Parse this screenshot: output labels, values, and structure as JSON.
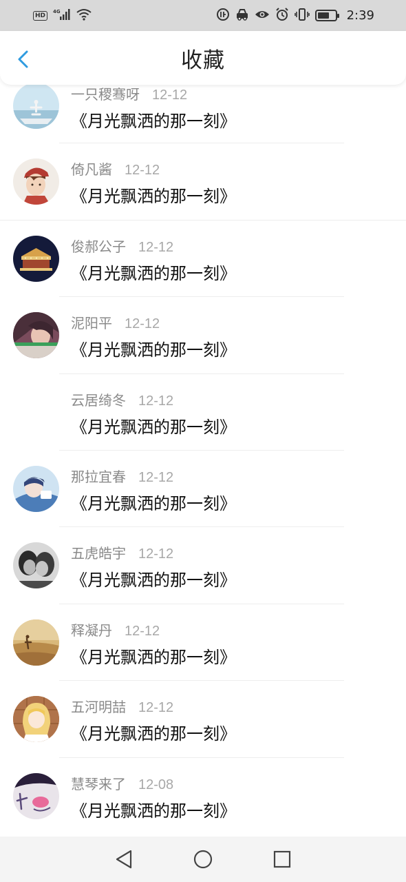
{
  "status_bar": {
    "left_icons": [
      "hd-icon",
      "signal-4g-icon",
      "wifi-icon"
    ],
    "hd_label": "HD",
    "network_label": "4G",
    "right_icons": [
      "data-saver-icon",
      "car-icon",
      "eye-icon",
      "alarm-icon",
      "vibrate-icon",
      "battery-icon"
    ],
    "battery_level": 0.7,
    "time": "2:39"
  },
  "header": {
    "title": "收藏",
    "back_icon": "chevron-left-icon",
    "accent_color": "#2f9be0"
  },
  "favorites": [
    {
      "user": "一只稷骞呀",
      "date": "12-12",
      "title": "《月光飘洒的那一刻》",
      "avatar": "yoga-figure-avatar"
    },
    {
      "user": "倚凡酱",
      "date": "12-12",
      "title": "《月光飘洒的那一刻》",
      "avatar": "anime-boy-red-cap-avatar"
    },
    {
      "user": "俊郝公子",
      "date": "12-12",
      "title": "《月光飘洒的那一刻》",
      "avatar": "carousel-night-avatar"
    },
    {
      "user": "泥阳平",
      "date": "12-12",
      "title": "《月光飘洒的那一刻》",
      "avatar": "girl-portrait-avatar"
    },
    {
      "user": "云居绮冬",
      "date": "12-12",
      "title": "《月光飘洒的那一刻》",
      "avatar": "blank-avatar"
    },
    {
      "user": "那拉宜春",
      "date": "12-12",
      "title": "《月光飘洒的那一刻》",
      "avatar": "blue-anime-avatar"
    },
    {
      "user": "五虎皓宇",
      "date": "12-12",
      "title": "《月光飘洒的那一刻》",
      "avatar": "couple-kiss-avatar"
    },
    {
      "user": "释凝丹",
      "date": "12-12",
      "title": "《月光飘洒的那一刻》",
      "avatar": "desert-figure-avatar"
    },
    {
      "user": "五河明喆",
      "date": "12-12",
      "title": "《月光飘洒的那一刻》",
      "avatar": "blonde-anime-girl-avatar"
    },
    {
      "user": "慧琴来了",
      "date": "12-08",
      "title": "《月光飘洒的那一刻》",
      "avatar": "i-love-you-paper-avatar"
    }
  ],
  "nav_bar": {
    "icons": [
      "nav-back-icon",
      "nav-home-icon",
      "nav-recents-icon"
    ]
  }
}
